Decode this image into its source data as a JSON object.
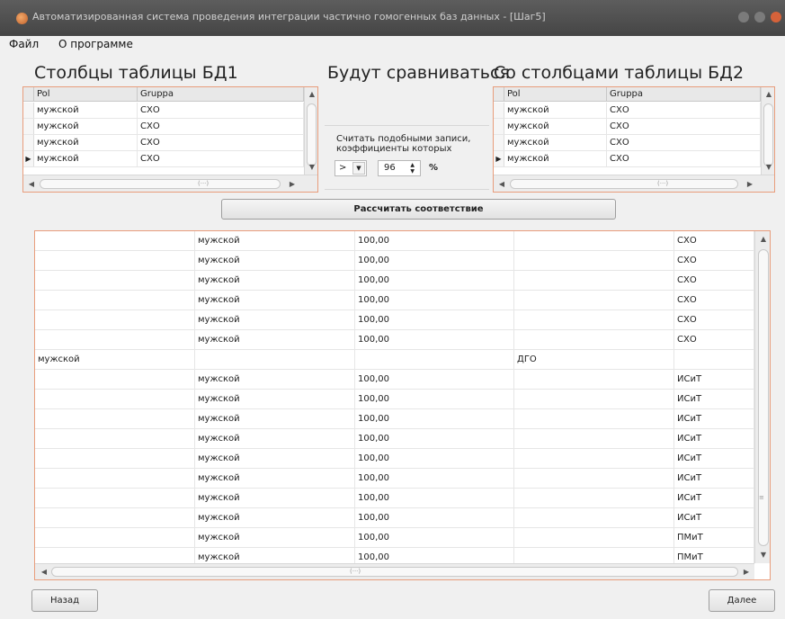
{
  "window": {
    "title": "Автоматизированная система проведения интеграции частично гомогенных баз данных - [Шаг5]"
  },
  "menu": {
    "file": "Файл",
    "about": "О программе"
  },
  "labels": {
    "left_title": "Столбцы таблицы БД1",
    "middle_title": "Будут сравниваться",
    "right_title": "Со столбцами таблицы БД2"
  },
  "left_table": {
    "columns": [
      "Pol",
      "Gruppa"
    ],
    "rows": [
      [
        "мужской",
        "СХО"
      ],
      [
        "мужской",
        "СХО"
      ],
      [
        "мужской",
        "СХО"
      ],
      [
        "мужской",
        "СХО"
      ]
    ]
  },
  "right_table": {
    "columns": [
      "Pol",
      "Gruppa"
    ],
    "rows": [
      [
        "мужской",
        "СХО"
      ],
      [
        "мужской",
        "СХО"
      ],
      [
        "мужской",
        "СХО"
      ],
      [
        "мужской",
        "СХО"
      ]
    ]
  },
  "compare": {
    "note": "Считать подобными записи, коэффициенты которых",
    "operator": ">",
    "threshold": "96",
    "percent": "%"
  },
  "buttons": {
    "calculate": "Рассчитать соответствие",
    "back": "Назад",
    "next": "Далее"
  },
  "results": {
    "rows": [
      [
        "",
        "мужской",
        "100,00",
        "",
        "СХО"
      ],
      [
        "",
        "мужской",
        "100,00",
        "",
        "СХО"
      ],
      [
        "",
        "мужской",
        "100,00",
        "",
        "СХО"
      ],
      [
        "",
        "мужской",
        "100,00",
        "",
        "СХО"
      ],
      [
        "",
        "мужской",
        "100,00",
        "",
        "СХО"
      ],
      [
        "",
        "мужской",
        "100,00",
        "",
        "СХО"
      ],
      [
        "мужской",
        "",
        "",
        "ДГО",
        ""
      ],
      [
        "",
        "мужской",
        "100,00",
        "",
        "ИСиТ"
      ],
      [
        "",
        "мужской",
        "100,00",
        "",
        "ИСиТ"
      ],
      [
        "",
        "мужской",
        "100,00",
        "",
        "ИСиТ"
      ],
      [
        "",
        "мужской",
        "100,00",
        "",
        "ИСиТ"
      ],
      [
        "",
        "мужской",
        "100,00",
        "",
        "ИСиТ"
      ],
      [
        "",
        "мужской",
        "100,00",
        "",
        "ИСиТ"
      ],
      [
        "",
        "мужской",
        "100,00",
        "",
        "ИСиТ"
      ],
      [
        "",
        "мужской",
        "100,00",
        "",
        "ИСиТ"
      ],
      [
        "",
        "мужской",
        "100,00",
        "",
        "ПМиТ"
      ],
      [
        "",
        "мужской",
        "100,00",
        "",
        "ПМиТ"
      ]
    ]
  },
  "colors": {
    "accent_border": "#e89d7c",
    "titlebar": "#4f4f4f"
  }
}
